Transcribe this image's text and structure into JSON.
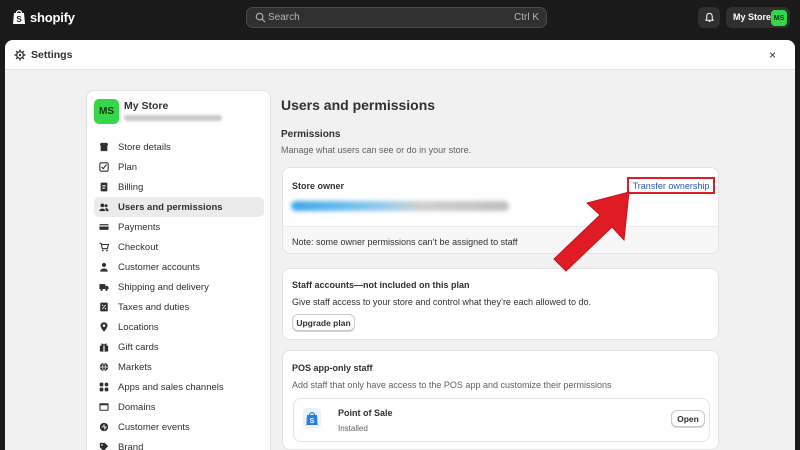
{
  "topbar": {
    "brand": "shopify",
    "search_placeholder": "Search",
    "search_shortcut": "Ctrl K",
    "store_name": "My Store",
    "store_initials": "MS"
  },
  "modal": {
    "title": "Settings",
    "close": "×"
  },
  "sidebar": {
    "store_name": "My Store",
    "store_initials": "MS",
    "items": [
      {
        "label": "Store details",
        "icon": "store-icon"
      },
      {
        "label": "Plan",
        "icon": "plan-icon"
      },
      {
        "label": "Billing",
        "icon": "billing-icon"
      },
      {
        "label": "Users and permissions",
        "icon": "users-icon",
        "active": true
      },
      {
        "label": "Payments",
        "icon": "payments-icon"
      },
      {
        "label": "Checkout",
        "icon": "cart-icon"
      },
      {
        "label": "Customer accounts",
        "icon": "person-icon"
      },
      {
        "label": "Shipping and delivery",
        "icon": "truck-icon"
      },
      {
        "label": "Taxes and duties",
        "icon": "tax-icon"
      },
      {
        "label": "Locations",
        "icon": "location-icon"
      },
      {
        "label": "Gift cards",
        "icon": "gift-icon"
      },
      {
        "label": "Markets",
        "icon": "globe-icon"
      },
      {
        "label": "Apps and sales channels",
        "icon": "apps-icon"
      },
      {
        "label": "Domains",
        "icon": "domain-icon"
      },
      {
        "label": "Customer events",
        "icon": "events-icon"
      },
      {
        "label": "Brand",
        "icon": "brand-icon"
      }
    ]
  },
  "main": {
    "title": "Users and permissions",
    "permissions_heading": "Permissions",
    "permissions_desc": "Manage what users can see or do in your store.",
    "owner_card": {
      "title": "Store owner",
      "transfer_link": "Transfer ownership",
      "note": "Note: some owner permissions can’t be assigned to staff"
    },
    "staff_card": {
      "title": "Staff accounts—not included on this plan",
      "desc": "Give staff access to your store and control what they’re each allowed to do.",
      "button": "Upgrade plan"
    },
    "pos_card": {
      "title": "POS app-only staff",
      "desc": "Add staff that only have access to the POS app and customize their permissions",
      "app_name": "Point of Sale",
      "app_status": "Installed",
      "button": "Open"
    }
  },
  "colors": {
    "accent_green": "#36d64a",
    "link_blue": "#2a5db0",
    "annotation_red": "#e01b24"
  }
}
